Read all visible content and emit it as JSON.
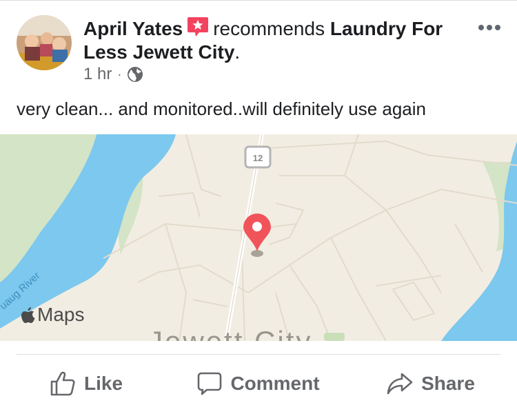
{
  "post": {
    "author": "April Yates",
    "verb": "recommends",
    "page_name": "Laundry For Less Jewett City",
    "page_suffix": ".",
    "time": "1 hr",
    "separator": "·",
    "privacy_icon": "globe-icon",
    "body": "very clean... and monitored..will definitely use again"
  },
  "map": {
    "route_label": "12",
    "river_label": "uaug River",
    "city_label": "Jewett City",
    "attribution": "Maps",
    "pin_color": "#f0545a",
    "water_color": "#7cc8ee",
    "park_color": "#d4e4c6"
  },
  "actions": {
    "like": "Like",
    "comment": "Comment",
    "share": "Share"
  }
}
